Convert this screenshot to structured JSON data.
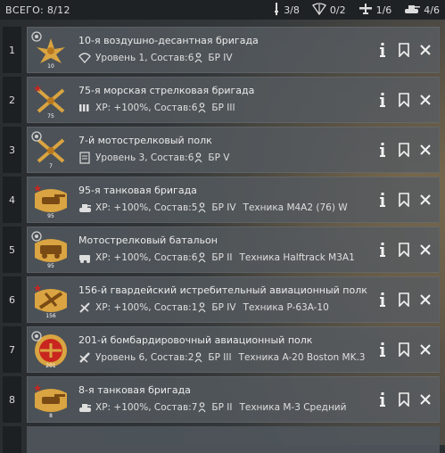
{
  "header": {
    "total": "ВСЕГО: 8/12",
    "stats": [
      {
        "icon": "infantry-icon",
        "value": "3/8"
      },
      {
        "icon": "paratrooper-icon",
        "value": "0/2"
      },
      {
        "icon": "aircraft-icon",
        "value": "1/6"
      },
      {
        "icon": "tank-icon",
        "value": "4/6"
      }
    ]
  },
  "units": [
    {
      "num": "1",
      "title": "10-я воздушно-десантная бригада",
      "sub_icon": "parachute-icon",
      "detail": "Уровень 1, Состав:6",
      "br": "БР IV",
      "vehicle": "",
      "emblem": "paratrooper-emblem",
      "level": "10",
      "star": false
    },
    {
      "num": "2",
      "title": "75-я морская стрелковая бригада",
      "sub_icon": "ammo-icon",
      "detail": "ХР: +100%, Состав:6",
      "br": "БР III",
      "vehicle": "",
      "emblem": "rifle-emblem",
      "level": "75",
      "star": true
    },
    {
      "num": "3",
      "title": "7-й мотострелковый полк",
      "sub_icon": "document-icon",
      "detail": "Уровень 3, Состав:6",
      "br": "БР V",
      "vehicle": "",
      "emblem": "rifle-emblem",
      "level": "7",
      "star": false
    },
    {
      "num": "4",
      "title": "95-я танковая бригада",
      "sub_icon": "tank-icon",
      "detail": "ХР: +100%, Состав:5",
      "br": "БР IV",
      "vehicle": "Техника M4A2 (76) W",
      "emblem": "tank-emblem",
      "level": "95",
      "star": true
    },
    {
      "num": "5",
      "title": "Мотострелковый батальон",
      "sub_icon": "truck-icon",
      "detail": "ХР: +100%, Состав:6",
      "br": "БР II",
      "vehicle": "Техника Halftrack M3A1",
      "emblem": "truck-emblem",
      "level": "95",
      "star": false
    },
    {
      "num": "6",
      "title": "156-й гвардейский истребительный авиационный полк",
      "sub_icon": "fighter-icon",
      "detail": "ХР: +100%, Состав:1",
      "br": "БР IV",
      "vehicle": "Техника P-63A-10",
      "emblem": "plane-emblem",
      "level": "156",
      "star": true
    },
    {
      "num": "7",
      "title": "201-й бомбардировочный авиационный полк",
      "sub_icon": "bomber-icon",
      "detail": "Уровень 6, Состав:2",
      "br": "БР III",
      "vehicle": "Техника A-20 Boston MK.3",
      "emblem": "bomber-emblem",
      "level": "201",
      "star": false
    },
    {
      "num": "8",
      "title": "8-я танковая бригада",
      "sub_icon": "tank-icon",
      "detail": "ХР: +100%, Состав:7",
      "br": "БР II",
      "vehicle": "Техника М-3 Средний",
      "emblem": "tank-emblem",
      "level": "8",
      "star": true
    }
  ],
  "colors": {
    "accent_red": "#c8261f",
    "emblem_gold": "#d9a441"
  }
}
